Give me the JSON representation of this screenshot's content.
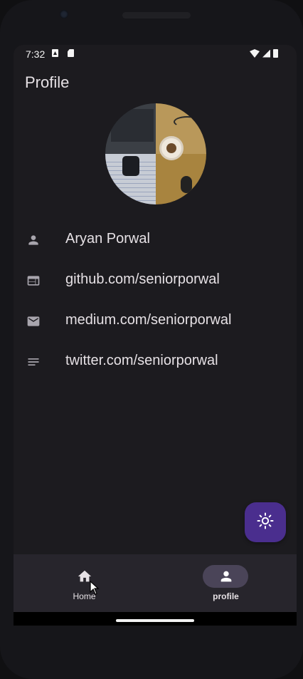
{
  "status_bar": {
    "time": "7:32"
  },
  "app_bar": {
    "title": "Profile"
  },
  "profile": {
    "avatar_alt": "",
    "items": [
      {
        "icon": "person-icon",
        "text": "Aryan Porwal"
      },
      {
        "icon": "web-icon",
        "text": "github.com/seniorporwal"
      },
      {
        "icon": "mail-icon",
        "text": "medium.com/seniorporwal"
      },
      {
        "icon": "notes-icon",
        "text": "twitter.com/seniorporwal"
      }
    ]
  },
  "fab": {
    "icon": "sun-icon"
  },
  "bottom_nav": {
    "items": [
      {
        "label": "Home",
        "icon": "home-icon",
        "selected": false
      },
      {
        "label": "profile",
        "icon": "person-icon",
        "selected": true
      }
    ]
  },
  "colors": {
    "background": "#1c1b1f",
    "text": "#e6e1e5",
    "icon": "#a8a5ad",
    "fab": "#4a2e8e",
    "nav_bar": "#27252c",
    "nav_pill": "#4a4458"
  }
}
